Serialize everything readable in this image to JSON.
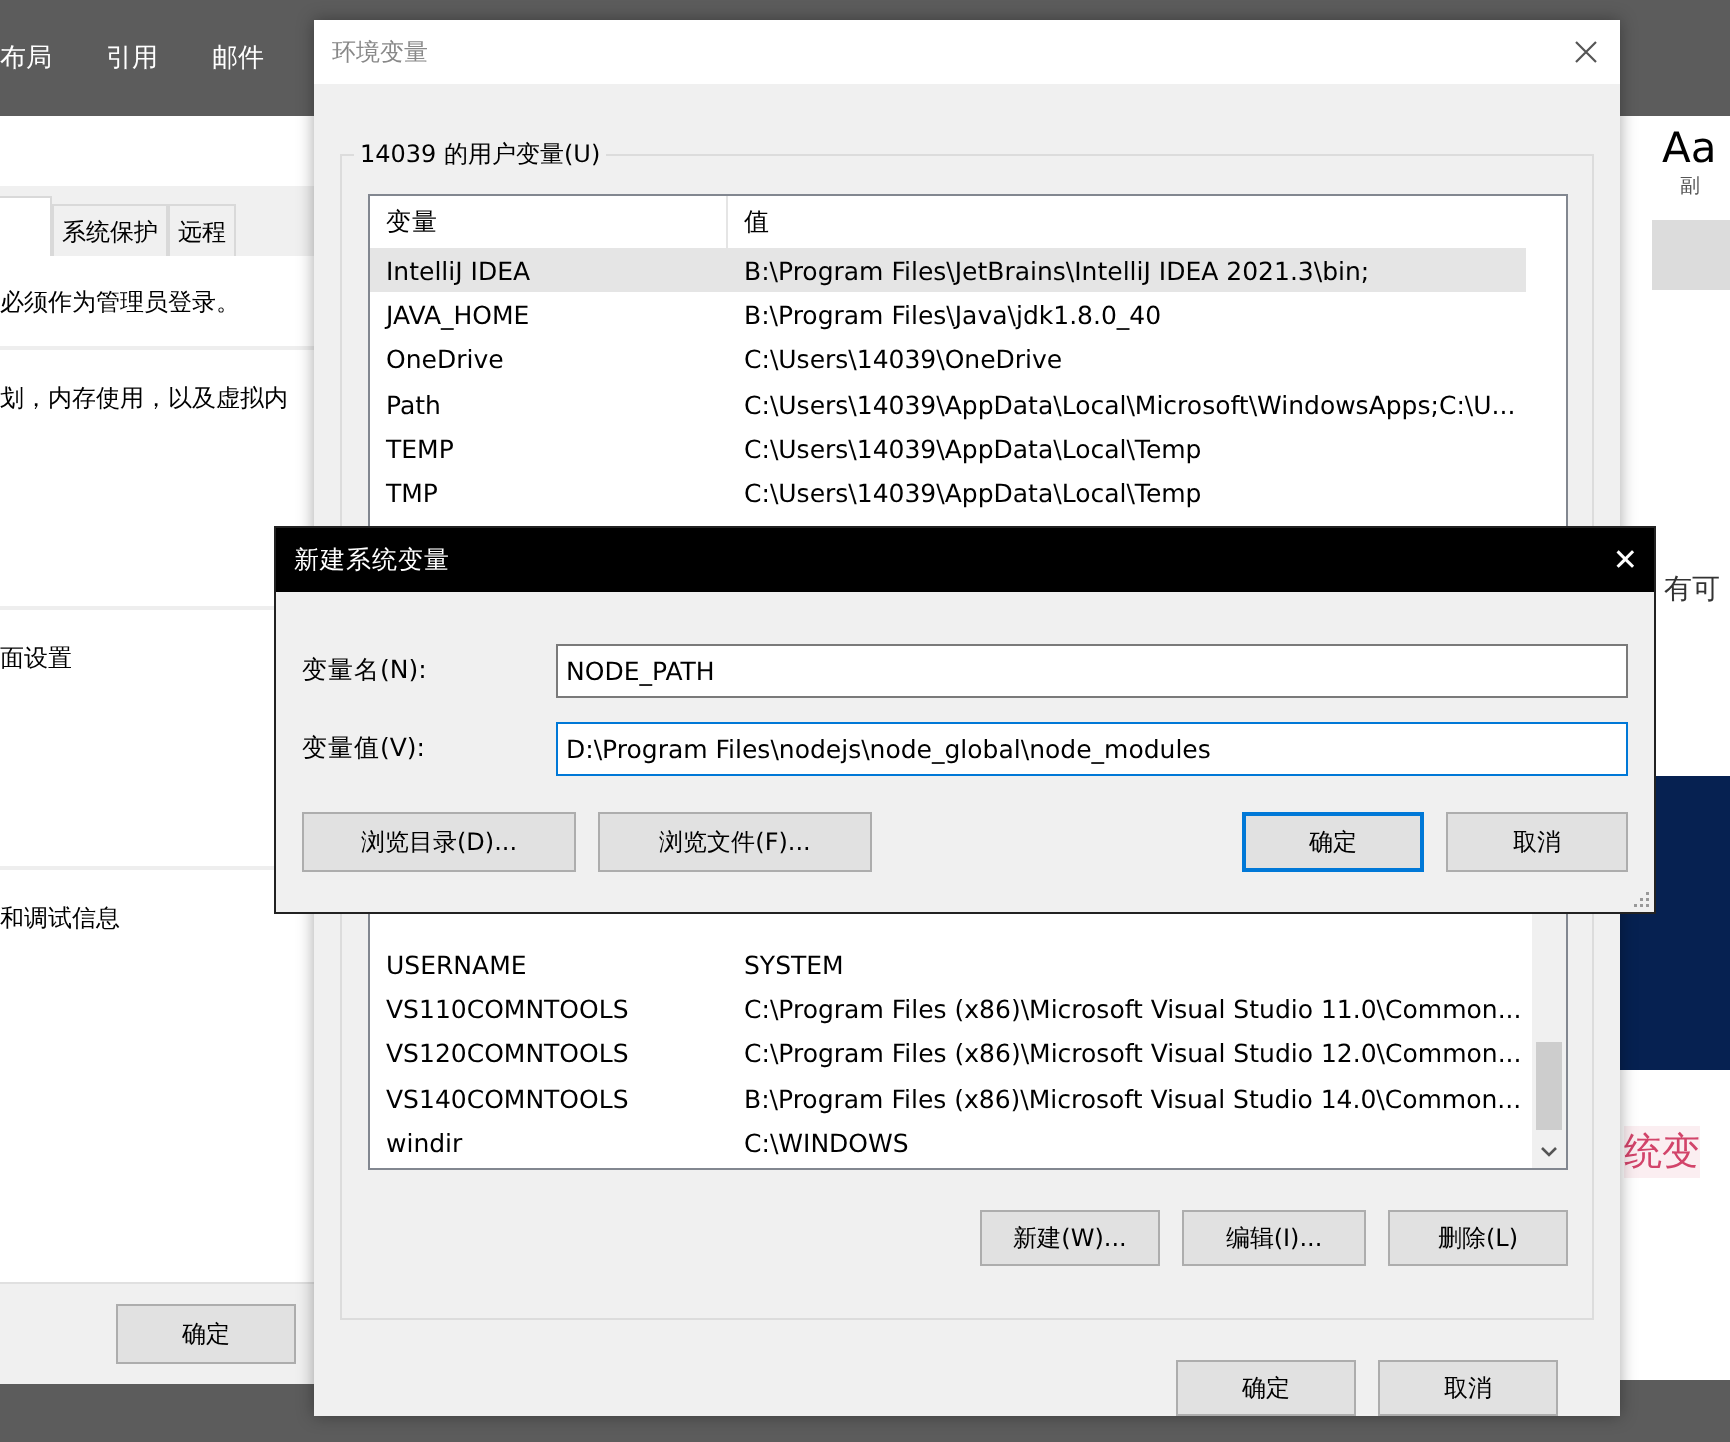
{
  "word": {
    "ribbon_tabs": [
      "布局",
      "引用",
      "邮件"
    ],
    "style_gallery": [
      {
        "sample": "Aa",
        "label": "副"
      }
    ],
    "doc_texts": [
      {
        "kind": "plain",
        "text": "有可"
      },
      {
        "kind": "highlight",
        "text": "统变"
      }
    ]
  },
  "system_properties": {
    "tabs": [
      {
        "label": "系统保护",
        "selected": false
      },
      {
        "label": "远程",
        "selected": false
      }
    ],
    "notice": "必须作为管理员登录。",
    "sections": [
      "划，内存使用，以及虚拟内",
      "面设置",
      "和调试信息"
    ],
    "ok_button": "确定"
  },
  "environment_dialog": {
    "title": "环境变量",
    "user_group": "14039 的用户变量(U)",
    "user_columns": [
      "变量",
      "值"
    ],
    "user_rows": [
      {
        "name": "IntelliJ IDEA",
        "value": "B:\\Program Files\\JetBrains\\IntelliJ IDEA 2021.3\\bin;",
        "selected": true
      },
      {
        "name": "JAVA_HOME",
        "value": "B:\\Program Files\\Java\\jdk1.8.0_40",
        "selected": false
      },
      {
        "name": "OneDrive",
        "value": "C:\\Users\\14039\\OneDrive",
        "selected": false
      },
      {
        "name": "Path",
        "value": "C:\\Users\\14039\\AppData\\Local\\Microsoft\\WindowsApps;C:\\U...",
        "selected": false
      },
      {
        "name": "TEMP",
        "value": "C:\\Users\\14039\\AppData\\Local\\Temp",
        "selected": false
      },
      {
        "name": "TMP",
        "value": "C:\\Users\\14039\\AppData\\Local\\Temp",
        "selected": false
      }
    ],
    "system_rows": [
      {
        "name": "USERNAME",
        "value": "SYSTEM",
        "selected": false
      },
      {
        "name": "VS110COMNTOOLS",
        "value": "C:\\Program Files (x86)\\Microsoft Visual Studio 11.0\\Common...",
        "selected": false
      },
      {
        "name": "VS120COMNTOOLS",
        "value": "C:\\Program Files (x86)\\Microsoft Visual Studio 12.0\\Common...",
        "selected": false
      },
      {
        "name": "VS140COMNTOOLS",
        "value": "B:\\Program Files (x86)\\Microsoft Visual Studio 14.0\\Common...",
        "selected": false
      },
      {
        "name": "windir",
        "value": "C:\\WINDOWS",
        "selected": false
      }
    ],
    "system_buttons": [
      "新建(W)...",
      "编辑(I)...",
      "删除(L)"
    ],
    "buttons": [
      {
        "label": "确定",
        "default": false
      },
      {
        "label": "取消",
        "default": false
      }
    ]
  },
  "new_variable_dialog": {
    "title": "新建系统变量",
    "close": "✕",
    "fields": [
      {
        "label": "变量名(N):",
        "value": "NODE_PATH",
        "focused": false
      },
      {
        "label": "变量值(V):",
        "value": "D:\\Program Files\\nodejs\\node_global\\node_modules",
        "focused": true
      }
    ],
    "browse_buttons": [
      "浏览目录(D)...",
      "浏览文件(F)..."
    ],
    "buttons": [
      {
        "label": "确定",
        "default": true
      },
      {
        "label": "取消",
        "default": false
      }
    ]
  }
}
